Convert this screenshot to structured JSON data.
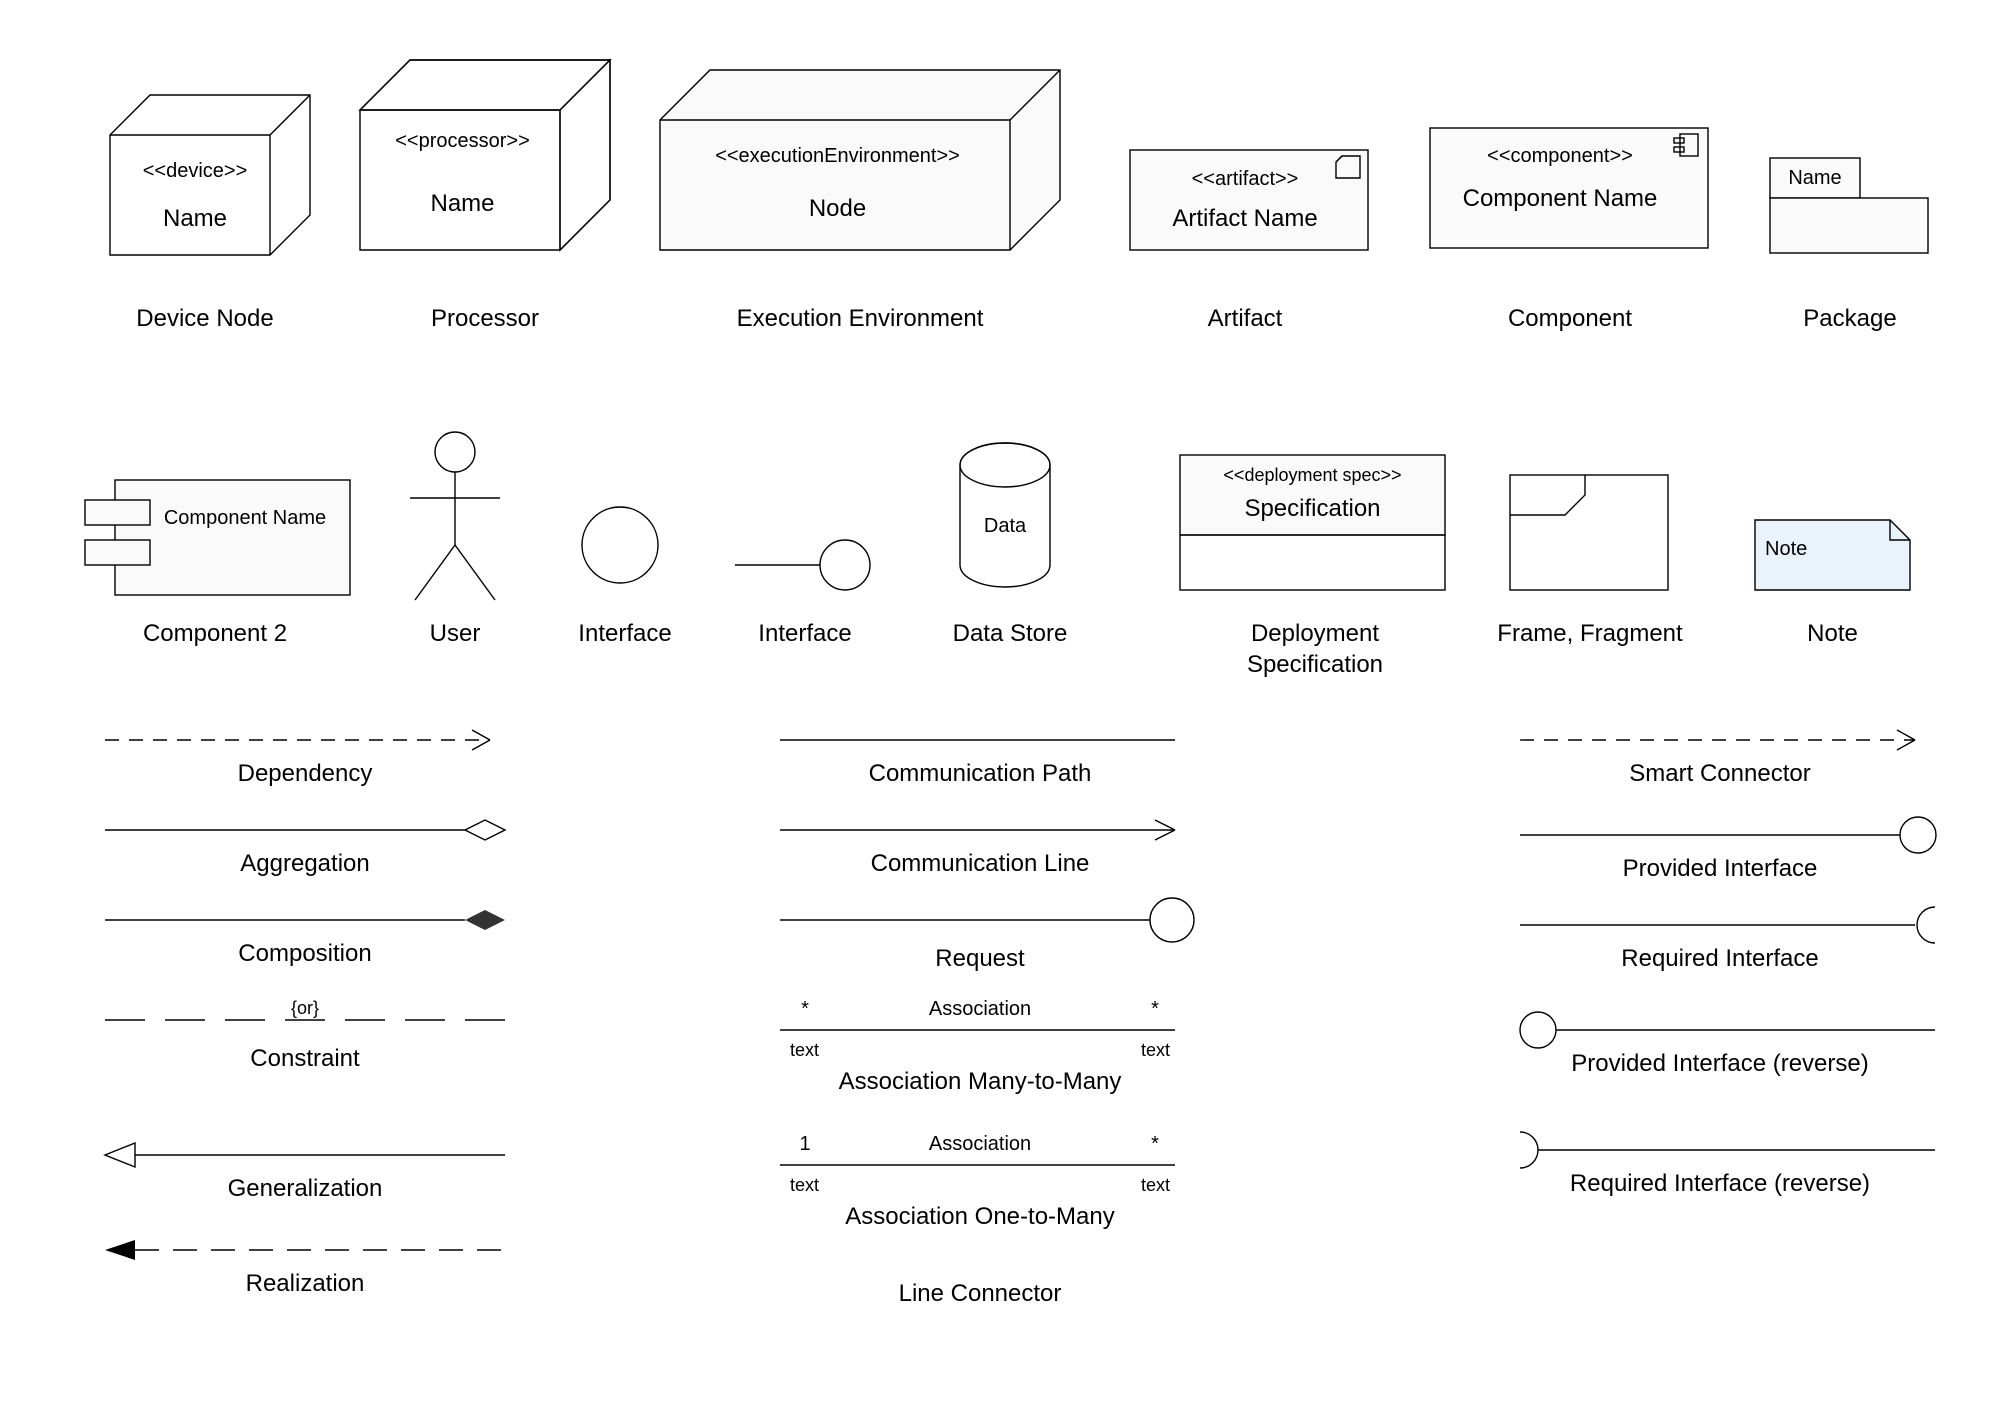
{
  "row1": {
    "device": {
      "stereo": "<<device>>",
      "name": "Name",
      "caption": "Device Node"
    },
    "processor": {
      "stereo": "<<processor>>",
      "name": "Name",
      "caption": "Processor"
    },
    "exec": {
      "stereo": "<<executionEnvironment>>",
      "name": "Node",
      "caption": "Execution Environment"
    },
    "artifact": {
      "stereo": "<<artifact>>",
      "name": "Artifact Name",
      "caption": "Artifact"
    },
    "component": {
      "stereo": "<<component>>",
      "name": "Component Name",
      "caption": "Component"
    },
    "package": {
      "name": "Name",
      "caption": "Package"
    }
  },
  "row2": {
    "component2": {
      "name": "Component Name",
      "caption": "Component 2"
    },
    "user": {
      "caption": "User"
    },
    "iface1": {
      "caption": "Interface"
    },
    "iface2": {
      "caption": "Interface"
    },
    "datastore": {
      "name": "Data",
      "caption": "Data Store"
    },
    "deploy": {
      "stereo": "<<deployment spec>>",
      "name": "Specification",
      "caption": "Deployment Specification"
    },
    "frame": {
      "caption": "Frame, Fragment"
    },
    "note": {
      "name": "Note",
      "caption": "Note"
    }
  },
  "col1": {
    "dependency": "Dependency",
    "aggregation": "Aggregation",
    "composition": "Composition",
    "constraint": "Constraint",
    "constraintTag": "{or}",
    "generalization": "Generalization",
    "realization": "Realization"
  },
  "col2": {
    "commPath": "Communication Path",
    "commLine": "Communication Line",
    "request": "Request",
    "assocMany": "Association Many-to-Many",
    "assocOne": "Association One-to-Many",
    "assocLabel": "Association",
    "star": "*",
    "one": "1",
    "text": "text",
    "lineConnector": "Line Connector"
  },
  "col3": {
    "smart": "Smart Connector",
    "providedIface": "Provided Interface",
    "requiredIface": "Required Interface",
    "providedRev": "Provided Interface (reverse)",
    "requiredRev": "Required Interface (reverse)"
  }
}
